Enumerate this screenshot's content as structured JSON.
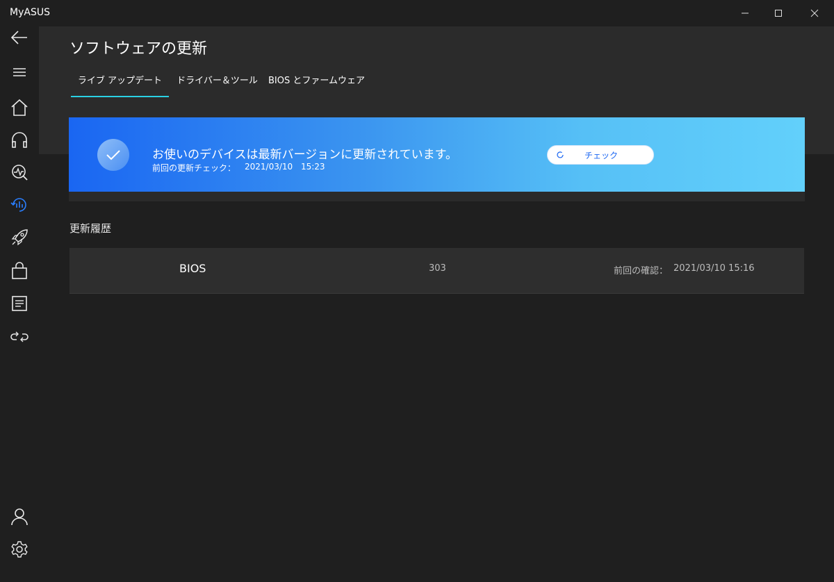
{
  "app": {
    "title": "MyASUS"
  },
  "colors": {
    "accent": "#2ad1e4",
    "banner_start": "#1a66f2",
    "banner_end": "#62d0fb",
    "background": "#1f1f1f",
    "panel": "#2b2b2b"
  },
  "sidebar": {
    "items": [
      {
        "icon": "back-arrow-icon"
      },
      {
        "icon": "hamburger-menu-icon"
      },
      {
        "icon": "home-icon"
      },
      {
        "icon": "headset-icon"
      },
      {
        "icon": "diagnostics-icon"
      },
      {
        "icon": "update-icon",
        "active": true
      },
      {
        "icon": "rocket-icon"
      },
      {
        "icon": "shopping-bag-icon"
      },
      {
        "icon": "news-icon"
      },
      {
        "icon": "link-icon"
      },
      {
        "icon": "user-icon"
      },
      {
        "icon": "settings-icon"
      }
    ]
  },
  "page": {
    "title": "ソフトウェアの更新"
  },
  "tabs": [
    {
      "label": "ライブ アップデート",
      "active": true
    },
    {
      "label": "ドライバー＆ツール",
      "active": false
    },
    {
      "label": "BIOS とファームウェア",
      "active": false
    }
  ],
  "status": {
    "message": "お使いのデバイスは最新バージョンに更新されています。",
    "last_check_label": "前回の更新チェック：",
    "last_check_value": "2021/03/10 15:23",
    "check_button": "チェック"
  },
  "history": {
    "title": "更新履歴",
    "rows": [
      {
        "name": "BIOS",
        "version": "303",
        "checked_label": "前回の確認：",
        "checked_value": "2021/03/10 15:16"
      }
    ]
  }
}
